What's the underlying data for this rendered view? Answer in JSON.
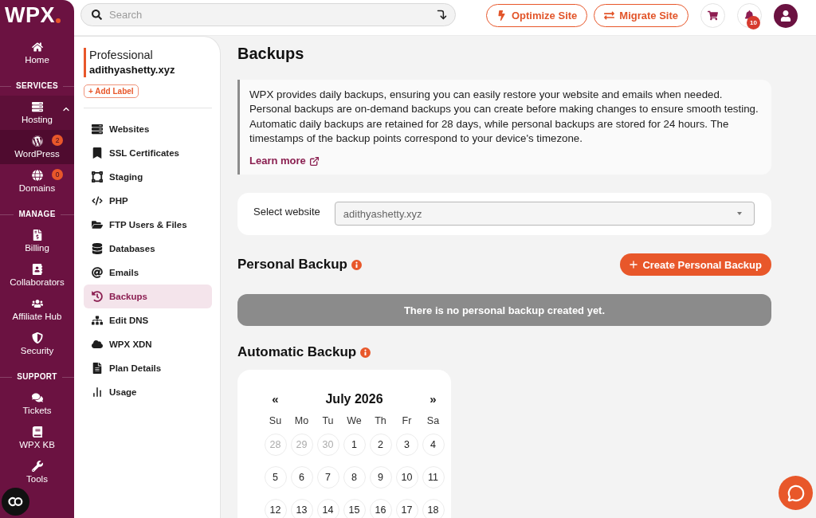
{
  "sidebar": {
    "logo": "WPX",
    "sections": [
      {
        "items": [
          {
            "label": "Home",
            "selected": false
          }
        ]
      },
      {
        "title": "SERVICES",
        "items": [
          {
            "label": "Hosting",
            "selected": false,
            "expanded": true,
            "children": [
              {
                "label": "WordPress",
                "selected": true,
                "badge": "2"
              }
            ]
          },
          {
            "label": "Domains",
            "selected": false,
            "badge": "0"
          }
        ]
      },
      {
        "title": "MANAGE",
        "items": [
          {
            "label": "Billing",
            "selected": false
          },
          {
            "label": "Collaborators",
            "selected": false
          },
          {
            "label": "Affiliate Hub",
            "selected": false
          },
          {
            "label": "Security",
            "selected": false
          }
        ]
      },
      {
        "title": "SUPPORT",
        "items": [
          {
            "label": "Tickets",
            "selected": false
          },
          {
            "label": "WPX KB",
            "selected": false
          },
          {
            "label": "Tools",
            "selected": false
          }
        ]
      }
    ]
  },
  "topbar": {
    "search": {
      "placeholder": "Search"
    },
    "actions": [
      {
        "label": "Optimize Site"
      },
      {
        "label": "Migrate Site"
      }
    ],
    "notifications": {
      "count": "10"
    }
  },
  "site_panel": {
    "plan": "Professional",
    "domain": "adithyashetty.xyz",
    "add_label": "+ Add Label",
    "items": [
      {
        "label": "Websites",
        "selected": false
      },
      {
        "label": "SSL Certificates",
        "selected": false
      },
      {
        "label": "Staging",
        "selected": false
      },
      {
        "label": "PHP",
        "selected": false
      },
      {
        "label": "FTP Users & Files",
        "selected": false
      },
      {
        "label": "Databases",
        "selected": false
      },
      {
        "label": "Emails",
        "selected": false
      },
      {
        "label": "Backups",
        "selected": true
      },
      {
        "label": "Edit DNS",
        "selected": false
      },
      {
        "label": "WPX XDN",
        "selected": false
      },
      {
        "label": "Plan Details",
        "selected": false
      },
      {
        "label": "Usage",
        "selected": false
      }
    ]
  },
  "content": {
    "title": "Backups",
    "notice": {
      "text": "WPX provides daily backups, ensuring you can easily restore your website and emails when needed. Personal backups are on-demand backups you can create before making changes to ensure smooth testing. Automatic daily backups are retained for 28 days, while personal backups are stored for 24 hours. The timestamps of the backup points correspond to your device's timezone.",
      "link": "Learn more"
    },
    "website_select": {
      "label": "Select website",
      "value": "adithyashetty.xyz"
    },
    "personal_backup": {
      "title": "Personal Backup",
      "button": "Create Personal Backup",
      "empty_message": "There is no personal backup created yet."
    },
    "automatic_backup": {
      "title": "Automatic Backup",
      "calendar": {
        "prev": "«",
        "month": "July 2026",
        "next": "»",
        "weekdays": [
          "Su",
          "Mo",
          "Tu",
          "We",
          "Th",
          "Fr",
          "Sa"
        ],
        "days": [
          {
            "label": "28",
            "outside": true
          },
          {
            "label": "29",
            "outside": true
          },
          {
            "label": "30",
            "outside": true
          },
          {
            "label": "1",
            "outside": false
          },
          {
            "label": "2",
            "outside": false
          },
          {
            "label": "3",
            "outside": false
          },
          {
            "label": "4",
            "outside": false
          },
          {
            "label": "5",
            "outside": false
          },
          {
            "label": "6",
            "outside": false
          },
          {
            "label": "7",
            "outside": false
          },
          {
            "label": "8",
            "outside": false
          },
          {
            "label": "9",
            "outside": false
          },
          {
            "label": "10",
            "outside": false
          },
          {
            "label": "11",
            "outside": false
          },
          {
            "label": "12",
            "outside": false
          },
          {
            "label": "13",
            "outside": false
          },
          {
            "label": "14",
            "outside": false
          },
          {
            "label": "15",
            "outside": false
          },
          {
            "label": "16",
            "outside": false
          },
          {
            "label": "17",
            "outside": false
          },
          {
            "label": "18",
            "outside": false
          }
        ]
      }
    }
  }
}
